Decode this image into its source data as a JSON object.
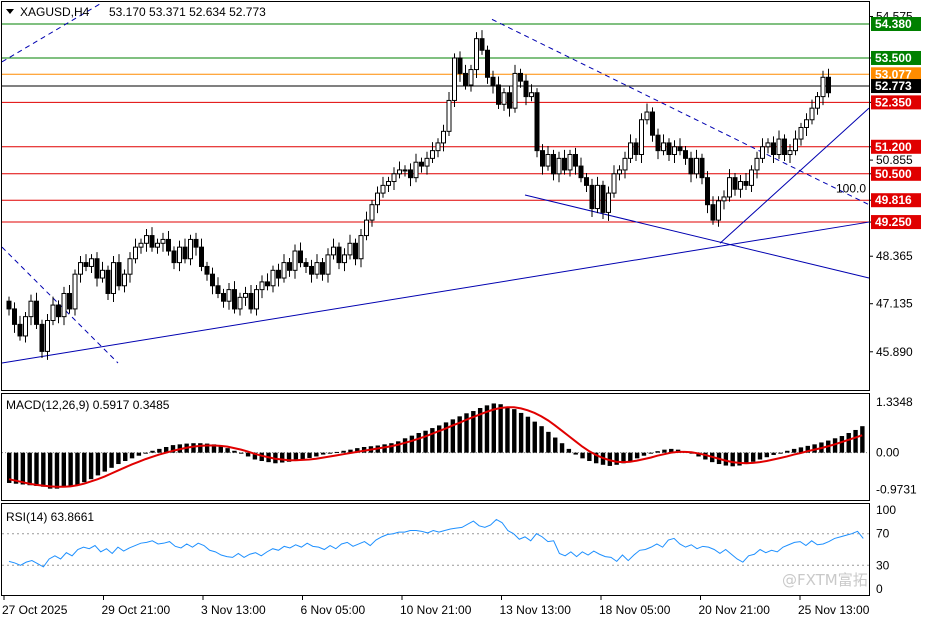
{
  "header": {
    "menu_icon": "triangle-down-icon",
    "symbol": "XAGUSD,H4",
    "ohlc": "53.170 53.371 52.634 52.773"
  },
  "watermark": "@FXTM富拓",
  "colors": {
    "bull": "#ffffff",
    "bear": "#000000",
    "support_resistance": "#e00000",
    "top_line": "#008000",
    "trendline": "#0000b0",
    "histogram": "#000000",
    "signal": "#e00000",
    "rsi": "#1e90ff",
    "current_price_bg": "#000000",
    "bid_line": "#ff8c00"
  },
  "chart_data": [
    {
      "type": "candlestick",
      "title": "XAGUSD,H4",
      "current_price": 52.773,
      "ylim": [
        44.9,
        54.95
      ],
      "y_ticks": [
        54.575,
        53.5,
        52.35,
        51.2,
        50.855,
        50.5,
        49.816,
        49.25,
        48.365,
        47.135,
        45.89
      ],
      "x_tick_labels": [
        "27 Oct 2025",
        "29 Oct 21:00",
        "3 Nov 13:00",
        "6 Nov 05:00",
        "10 Nov 21:00",
        "13 Nov 13:00",
        "18 Nov 05:00",
        "20 Nov 21:00",
        "25 Nov 13:00"
      ],
      "levels": [
        {
          "value": 54.38,
          "label": "54.380",
          "color": "#008000"
        },
        {
          "value": 53.5,
          "label": "53.500",
          "color": "#008000"
        },
        {
          "value": 53.077,
          "label": "53.077",
          "color": "#ff8c00"
        },
        {
          "value": 52.773,
          "label": "52.773",
          "color": "#000000"
        },
        {
          "value": 52.35,
          "label": "52.350",
          "color": "#e00000"
        },
        {
          "value": 51.2,
          "label": "51.200",
          "color": "#e00000"
        },
        {
          "value": 50.5,
          "label": "50.500",
          "color": "#e00000"
        },
        {
          "value": 49.816,
          "label": "49.816",
          "color": "#e00000"
        },
        {
          "value": 49.25,
          "label": "49.250",
          "color": "#e00000"
        }
      ],
      "fib_label": "100.0",
      "ohlc_close": [
        47.0,
        46.6,
        46.3,
        46.8,
        47.2,
        46.6,
        45.9,
        46.7,
        47.1,
        46.8,
        47.4,
        47.0,
        47.9,
        48.2,
        48.1,
        48.3,
        47.8,
        48.0,
        47.4,
        48.2,
        47.6,
        47.9,
        48.3,
        48.6,
        48.7,
        48.9,
        48.6,
        48.7,
        48.8,
        48.5,
        48.2,
        48.6,
        48.3,
        48.8,
        48.6,
        48.1,
        47.9,
        47.6,
        47.4,
        47.2,
        47.5,
        47.0,
        47.3,
        47.4,
        47.0,
        47.5,
        47.7,
        47.6,
        48.0,
        47.8,
        48.2,
        48.0,
        48.5,
        48.2,
        48.1,
        47.9,
        48.2,
        47.9,
        48.4,
        48.6,
        48.2,
        48.4,
        48.7,
        48.3,
        48.9,
        49.3,
        49.7,
        50.0,
        50.2,
        50.3,
        50.5,
        50.6,
        50.6,
        50.4,
        50.8,
        50.7,
        50.9,
        51.1,
        51.3,
        51.6,
        52.4,
        53.5,
        53.1,
        52.8,
        53.2,
        54.0,
        53.7,
        53.0,
        52.8,
        52.3,
        52.6,
        52.2,
        53.1,
        52.9,
        52.5,
        52.6,
        51.1,
        50.7,
        51.0,
        50.5,
        50.9,
        50.6,
        51.0,
        50.7,
        50.4,
        50.2,
        49.6,
        50.2,
        49.5,
        50.0,
        50.5,
        50.6,
        50.9,
        51.3,
        51.0,
        51.9,
        52.1,
        51.5,
        51.1,
        51.3,
        51.0,
        51.2,
        51.1,
        50.9,
        50.5,
        50.9,
        50.4,
        49.7,
        49.3,
        49.8,
        49.9,
        50.4,
        50.1,
        50.3,
        50.2,
        50.6,
        50.9,
        51.2,
        51.3,
        51.0,
        51.4,
        51.0,
        51.1,
        51.4,
        51.7,
        51.9,
        52.2,
        52.5,
        53.0,
        52.6
      ]
    },
    {
      "type": "bar",
      "title": "MACD(12,26,9) 0.5917 0.3485",
      "ylim": [
        -1.25,
        1.55
      ],
      "y_ticks": [
        1.3348,
        0.0,
        -0.9731
      ],
      "y_tick_labels": [
        "1.3348",
        "0.00",
        "-0.9731"
      ],
      "series": [
        {
          "name": "MACD",
          "kind": "histogram",
          "values": [
            -0.8,
            -0.82,
            -0.84,
            -0.86,
            -0.88,
            -0.9,
            -0.95,
            -0.95,
            -0.92,
            -0.9,
            -0.85,
            -0.78,
            -0.7,
            -0.6,
            -0.5,
            -0.4,
            -0.3,
            -0.22,
            -0.15,
            -0.08,
            -0.02,
            0.05,
            0.1,
            0.15,
            0.2,
            0.22,
            0.24,
            0.25,
            0.25,
            0.24,
            0.22,
            0.18,
            0.12,
            0.05,
            -0.02,
            -0.1,
            -0.18,
            -0.22,
            -0.25,
            -0.28,
            -0.26,
            -0.24,
            -0.22,
            -0.18,
            -0.14,
            -0.1,
            -0.05,
            -0.02,
            0.02,
            0.05,
            0.08,
            0.12,
            0.15,
            0.17,
            0.19,
            0.22,
            0.25,
            0.3,
            0.38,
            0.45,
            0.52,
            0.58,
            0.65,
            0.72,
            0.8,
            0.88,
            0.96,
            1.04,
            1.1,
            1.18,
            1.25,
            1.3,
            1.28,
            1.22,
            1.15,
            1.05,
            0.95,
            0.82,
            0.7,
            0.55,
            0.4,
            0.25,
            0.1,
            -0.05,
            -0.15,
            -0.22,
            -0.28,
            -0.32,
            -0.35,
            -0.32,
            -0.28,
            -0.22,
            -0.15,
            -0.08,
            -0.02,
            0.04,
            0.08,
            0.1,
            0.08,
            0.04,
            -0.02,
            -0.1,
            -0.18,
            -0.25,
            -0.3,
            -0.34,
            -0.36,
            -0.34,
            -0.3,
            -0.24,
            -0.18,
            -0.12,
            -0.06,
            0.0,
            0.05,
            0.1,
            0.14,
            0.18,
            0.22,
            0.27,
            0.32,
            0.38,
            0.44,
            0.52,
            0.6,
            0.7
          ]
        },
        {
          "name": "Signal",
          "kind": "line",
          "values": [
            -0.7,
            -0.74,
            -0.78,
            -0.82,
            -0.85,
            -0.87,
            -0.89,
            -0.9,
            -0.9,
            -0.89,
            -0.86,
            -0.82,
            -0.76,
            -0.7,
            -0.63,
            -0.55,
            -0.47,
            -0.39,
            -0.31,
            -0.24,
            -0.17,
            -0.11,
            -0.05,
            0.0,
            0.05,
            0.09,
            0.13,
            0.16,
            0.18,
            0.19,
            0.19,
            0.18,
            0.16,
            0.12,
            0.08,
            0.03,
            -0.03,
            -0.08,
            -0.12,
            -0.16,
            -0.18,
            -0.2,
            -0.2,
            -0.19,
            -0.18,
            -0.16,
            -0.13,
            -0.1,
            -0.07,
            -0.04,
            -0.01,
            0.02,
            0.05,
            0.08,
            0.11,
            0.14,
            0.17,
            0.21,
            0.26,
            0.31,
            0.37,
            0.43,
            0.5,
            0.57,
            0.64,
            0.72,
            0.79,
            0.87,
            0.94,
            1.01,
            1.08,
            1.14,
            1.18,
            1.2,
            1.2,
            1.17,
            1.12,
            1.05,
            0.96,
            0.85,
            0.72,
            0.58,
            0.44,
            0.3,
            0.16,
            0.04,
            -0.06,
            -0.14,
            -0.2,
            -0.24,
            -0.25,
            -0.24,
            -0.21,
            -0.17,
            -0.13,
            -0.08,
            -0.04,
            0.0,
            0.02,
            0.02,
            0.01,
            -0.02,
            -0.06,
            -0.11,
            -0.16,
            -0.21,
            -0.25,
            -0.27,
            -0.28,
            -0.27,
            -0.25,
            -0.22,
            -0.18,
            -0.14,
            -0.1,
            -0.05,
            -0.01,
            0.04,
            0.08,
            0.12,
            0.17,
            0.22,
            0.28,
            0.34,
            0.4,
            0.46
          ]
        }
      ]
    },
    {
      "type": "line",
      "title": "RSI(14) 63.8661",
      "ylim": [
        0,
        100
      ],
      "y_ticks": [
        100,
        70,
        30,
        0
      ],
      "y_tick_labels": [
        "100",
        "70",
        "30",
        "0"
      ],
      "series": [
        {
          "name": "RSI",
          "values": [
            35,
            33,
            30,
            34,
            36,
            32,
            28,
            38,
            42,
            38,
            46,
            42,
            50,
            53,
            51,
            55,
            47,
            51,
            45,
            53,
            48,
            52,
            55,
            58,
            59,
            61,
            57,
            58,
            60,
            54,
            52,
            57,
            53,
            58,
            55,
            49,
            47,
            43,
            41,
            40,
            45,
            40,
            44,
            46,
            42,
            47,
            51,
            49,
            54,
            52,
            56,
            53,
            58,
            54,
            53,
            50,
            55,
            51,
            57,
            59,
            54,
            57,
            60,
            55,
            62,
            66,
            69,
            70,
            72,
            72,
            74,
            74,
            73,
            71,
            74,
            72,
            74,
            76,
            77,
            78,
            82,
            86,
            80,
            78,
            81,
            88,
            84,
            74,
            70,
            63,
            66,
            61,
            70,
            66,
            60,
            61,
            45,
            42,
            47,
            41,
            47,
            43,
            48,
            44,
            41,
            40,
            35,
            43,
            36,
            43,
            49,
            50,
            53,
            57,
            53,
            62,
            64,
            57,
            53,
            56,
            51,
            54,
            53,
            50,
            45,
            50,
            44,
            38,
            34,
            42,
            44,
            50,
            46,
            49,
            47,
            53,
            56,
            59,
            60,
            55,
            61,
            56,
            57,
            60,
            64,
            66,
            68,
            70,
            73,
            64
          ]
        }
      ]
    }
  ]
}
